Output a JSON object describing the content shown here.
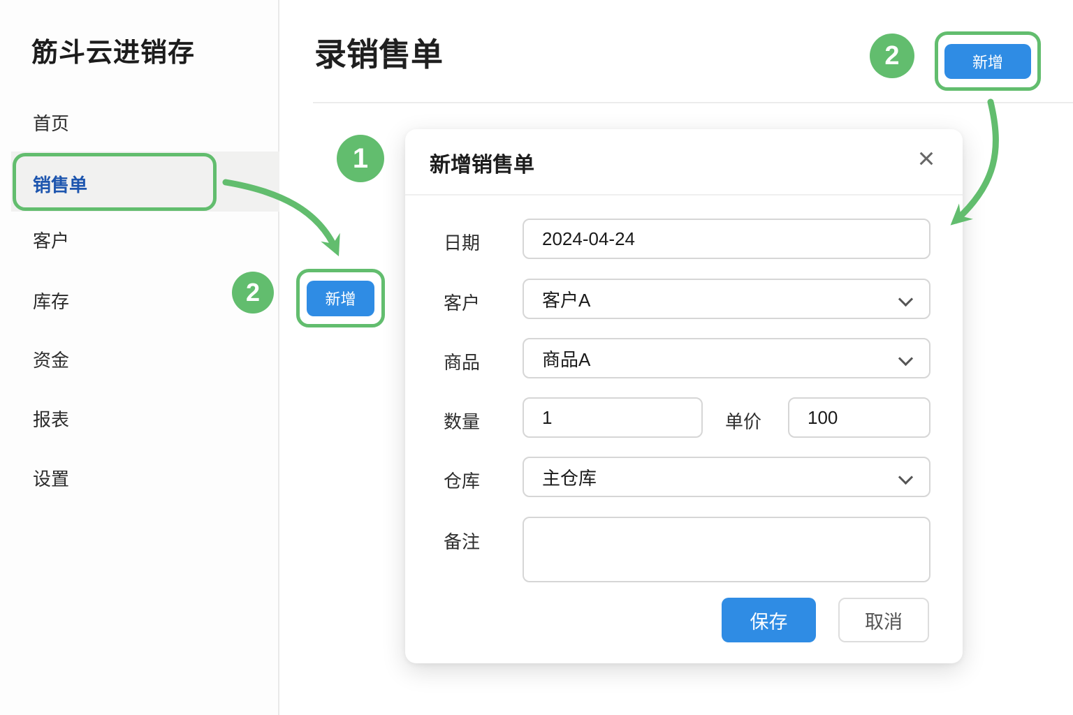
{
  "app": {
    "title": "筋斗云进销存"
  },
  "sidebar": {
    "items": [
      {
        "label": "首页",
        "active": false
      },
      {
        "label": "销售单",
        "active": true
      },
      {
        "label": "客户",
        "active": false
      },
      {
        "label": "库存",
        "active": false
      },
      {
        "label": "资金",
        "active": false
      },
      {
        "label": "报表",
        "active": false
      },
      {
        "label": "设置",
        "active": false
      }
    ]
  },
  "main": {
    "page_title": "录销售单",
    "add_button_label": "新增"
  },
  "annotations": {
    "badge_step_1": "1",
    "badge_step_2_sidebar": "2",
    "badge_step_2_topright": "2",
    "inline_add_button_label": "新增",
    "topright_add_button_label": "新增"
  },
  "modal": {
    "title": "新增销售单",
    "close_icon": "×",
    "fields": {
      "date": {
        "label": "日期",
        "value": "2024-04-24"
      },
      "customer": {
        "label": "客户",
        "value": "客户A"
      },
      "product": {
        "label": "商品",
        "value": "商品A"
      },
      "quantity": {
        "label": "数量",
        "value": "1"
      },
      "unit_price": {
        "label": "单价",
        "value": "100"
      },
      "warehouse": {
        "label": "仓库",
        "value": "主仓库"
      },
      "remark": {
        "label": "备注",
        "value": ""
      }
    },
    "buttons": {
      "save": "保存",
      "cancel": "取消"
    }
  },
  "colors": {
    "accent_green": "#62bd6e",
    "primary_blue": "#2f8ce4",
    "active_link_blue": "#1d55ae"
  }
}
